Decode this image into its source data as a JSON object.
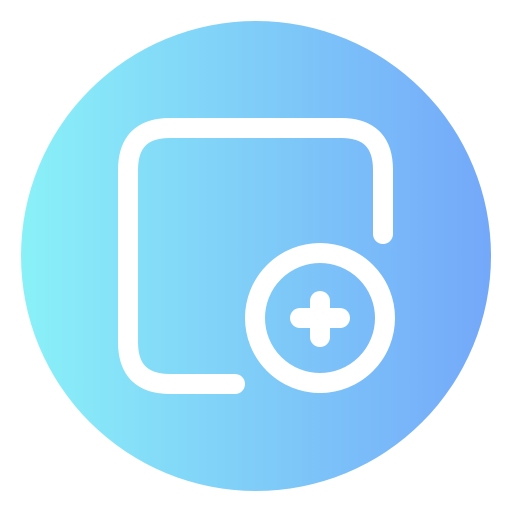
{
  "icon": {
    "name": "add-square-icon",
    "gradient_start": "#8AF1F8",
    "gradient_end": "#74A8F9",
    "stroke_color": "#ffffff"
  }
}
